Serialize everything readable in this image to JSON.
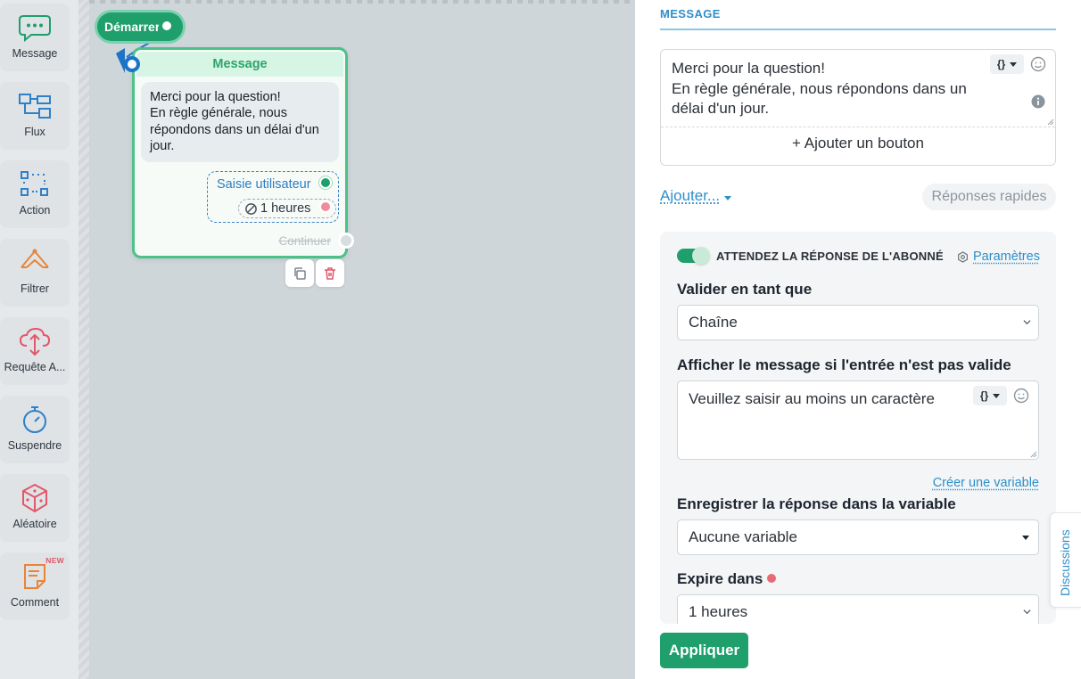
{
  "toolbar": {
    "items": [
      {
        "label": "Message",
        "icon": "chat-bubble-icon",
        "color": "#1e9f6b"
      },
      {
        "label": "Flux",
        "icon": "flow-icon",
        "color": "#2f80c8"
      },
      {
        "label": "Action",
        "icon": "action-grid-icon",
        "color": "#2f80c8"
      },
      {
        "label": "Filtrer",
        "icon": "filter-icon",
        "color": "#e8843a"
      },
      {
        "label": "Requête A...",
        "icon": "cloud-request-icon",
        "color": "#e0586a"
      },
      {
        "label": "Suspendre",
        "icon": "stopwatch-icon",
        "color": "#2f80c8"
      },
      {
        "label": "Aléatoire",
        "icon": "dice-icon",
        "color": "#e0586a"
      },
      {
        "label": "Comment",
        "icon": "note-icon",
        "color": "#e8843a",
        "badge": "NEW"
      }
    ]
  },
  "canvas": {
    "start_label": "Démarrer",
    "message_node": {
      "title": "Message",
      "bubble_text": "Merci pour la question!\nEn règle générale, nous répondons dans un délai d'un jour.",
      "user_input_label": "Saisie utilisateur",
      "timeout_label": "1 heures",
      "continue_label": "Continuer"
    }
  },
  "panel": {
    "tab_label": "MESSAGE",
    "message_text": "Merci pour la question!\nEn règle générale, nous répondons dans un\ndélai d'un jour.",
    "var_button": "{}",
    "add_button_label": "+ Ajouter un bouton",
    "add_link": "Ajouter...",
    "quick_replies": "Réponses rapides",
    "wait_toggle_label": "ATTENDEZ LA RÉPONSE DE L'ABONNÉ",
    "wait_toggle_on": true,
    "settings_link": "Paramètres",
    "validate_label": "Valider en tant que",
    "validate_value": "Chaîne",
    "invalid_msg_label": "Afficher le message si l'entrée n'est pas valide",
    "invalid_msg_value": "Veuillez saisir au moins un caractère",
    "create_variable": "Créer une variable",
    "save_var_label": "Enregistrer la réponse dans la variable",
    "save_var_value": "Aucune variable",
    "expire_label": "Expire dans",
    "expire_value": "1 heures",
    "apply_label": "Appliquer",
    "discussions_label": "Discussions"
  },
  "colors": {
    "accent_green": "#1e9f6b",
    "link_blue": "#2f8fca",
    "canvas_bg": "#ced6da"
  }
}
